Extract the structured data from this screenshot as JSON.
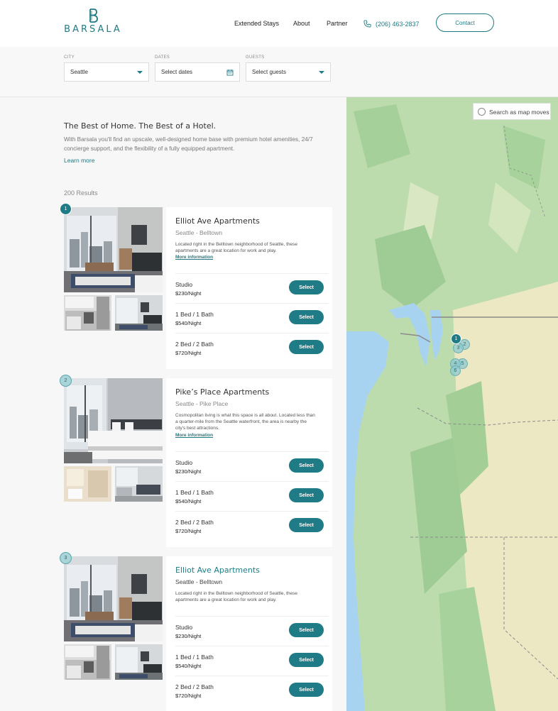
{
  "brand": {
    "name": "BARSALA"
  },
  "nav": {
    "items": [
      "Extended Stays",
      "About",
      "Partner"
    ],
    "phone": "(206) 463-2837",
    "contact_label": "Contact"
  },
  "filters": {
    "city": {
      "label": "CITY",
      "value": "Seattle"
    },
    "dates": {
      "label": "DATES",
      "value": "Select dates"
    },
    "guests": {
      "label": "GUESTS",
      "value": "Select guests"
    }
  },
  "intro": {
    "title": "The Best of Home. The Best of a Hotel.",
    "text": "With Barsala you'll find an upscale, well-designed home base with premium hotel amenities, 24/7 concierge support, and the flexibility of a fully equipped apartment.",
    "learn_more": "Learn more"
  },
  "results_count": "200 Results",
  "listings": [
    {
      "pin": "1",
      "title": "Elliot Ave Apartments",
      "subtitle": "Seattle - Belltown",
      "description": "Located right in the Belltown neighborhood of Seattle, these apartments are a great location for work and play.",
      "more_info": "More information",
      "rooms": [
        {
          "name": "Studio",
          "price": "$230/Night",
          "button": "Select"
        },
        {
          "name": "1 Bed / 1 Bath",
          "price": "$540/Night",
          "button": "Select"
        },
        {
          "name": "2 Bed / 2 Bath",
          "price": "$720/Night",
          "button": "Select"
        }
      ]
    },
    {
      "pin": "2",
      "title": "Pike’s Place Apartments",
      "subtitle": "Seattle - Pike Place",
      "description": "Cosmopolitan living is what this space is all about. Located less than a quarter-mile from the Seattle waterfront, the area is nearby the city's best attractions.",
      "more_info": "More information",
      "rooms": [
        {
          "name": "Studio",
          "price": "$230/Night",
          "button": "Select"
        },
        {
          "name": "1 Bed / 1 Bath",
          "price": "$540/Night",
          "button": "Select"
        },
        {
          "name": "2 Bed / 2 Bath",
          "price": "$720/Night",
          "button": "Select"
        }
      ]
    },
    {
      "pin": "3",
      "title": "Elliot Ave Apartments",
      "subtitle": "Seattle - Belltown",
      "description": "Located right in the Belltown neighborhood of Seattle, these apartments are a great location for work and play.",
      "rooms": [
        {
          "name": "Studio",
          "price": "$230/Night",
          "button": "Select"
        },
        {
          "name": "1 Bed / 1 Bath",
          "price": "$540/Night",
          "button": "Select"
        },
        {
          "name": "2 Bed / 2 Bath",
          "price": "$720/Night",
          "button": "Select"
        }
      ]
    }
  ],
  "map": {
    "toggle_label": "Search as map moves",
    "pins": [
      "1",
      "2",
      "3",
      "4",
      "5",
      "6"
    ]
  },
  "colors": {
    "accent": "#1f7b85",
    "water": "#a8d3f0",
    "land_green": "#bcdcae",
    "land_tan": "#ede8c4"
  }
}
